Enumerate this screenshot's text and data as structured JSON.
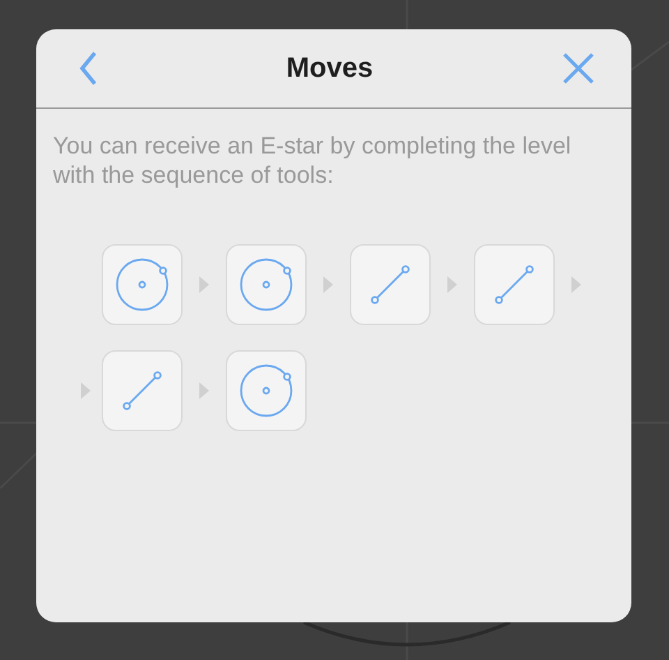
{
  "dialog": {
    "title": "Moves",
    "description": "You can receive an E-star by completing the level with the sequence of tools:",
    "tools": [
      {
        "kind": "circle"
      },
      {
        "kind": "circle"
      },
      {
        "kind": "line"
      },
      {
        "kind": "line"
      },
      {
        "kind": "line"
      },
      {
        "kind": "circle"
      }
    ]
  }
}
